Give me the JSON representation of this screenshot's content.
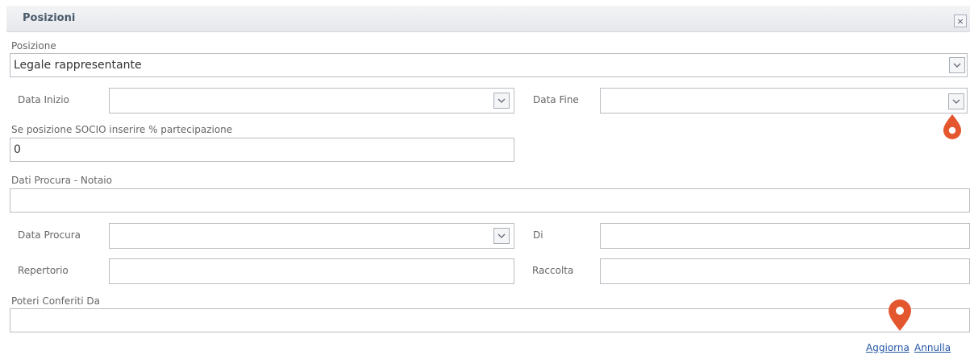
{
  "dialog": {
    "title": "Posizioni",
    "close_glyph": "×"
  },
  "form": {
    "posizione": {
      "label": "Posizione",
      "value": "Legale rappresentante"
    },
    "data_inizio": {
      "label": "Data Inizio",
      "value": ""
    },
    "data_fine": {
      "label": "Data Fine",
      "value": ""
    },
    "socio": {
      "label": "Se posizione SOCIO inserire % partecipazione",
      "value": "0"
    },
    "procura_notaio": {
      "label": "Dati Procura - Notaio",
      "value": ""
    },
    "data_procura": {
      "label": "Data Procura",
      "value": ""
    },
    "di": {
      "label": "Di",
      "value": ""
    },
    "repertorio": {
      "label": "Repertorio",
      "value": ""
    },
    "raccolta": {
      "label": "Raccolta",
      "value": ""
    },
    "poteri": {
      "label": "Poteri Conferiti Da",
      "value": ""
    }
  },
  "actions": {
    "aggiorna": "Aggiorna",
    "annulla": "Annulla"
  },
  "icons": {
    "dropdown": "chevron-down-icon",
    "marker": "map-pin-icon",
    "marker_color": "#e4572e"
  }
}
